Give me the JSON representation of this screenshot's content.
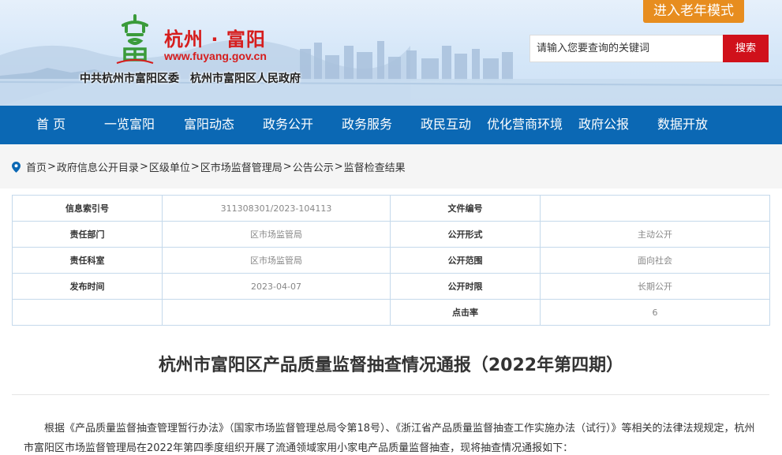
{
  "header": {
    "site_name": "杭州 · 富阳",
    "site_url": "www.fuyang.gov.cn",
    "org_1": "中共杭州市富阳区委",
    "org_2": "杭州市富阳区人民政府",
    "logo_icon": "fuyang-logo-icon",
    "elder_mode_label": "进入老年模式",
    "search_placeholder": "请输入您要查询的关键词",
    "search_button": "搜索",
    "colors": {
      "brand_red": "#d61d1d",
      "nav_blue": "#0b68b4",
      "elder_orange": "#e78d1f",
      "search_red": "#d0111b"
    }
  },
  "nav": {
    "items": [
      {
        "label": "首 页"
      },
      {
        "label": "一览富阳"
      },
      {
        "label": "富阳动态"
      },
      {
        "label": "政务公开"
      },
      {
        "label": "政务服务"
      },
      {
        "label": "政民互动"
      },
      {
        "label": "优化营商环境"
      },
      {
        "label": "政府公报"
      },
      {
        "label": "数据开放"
      }
    ]
  },
  "breadcrumb": {
    "icon": "location-pin-icon",
    "items": [
      "首页",
      "政府信息公开目录",
      "区级单位",
      "区市场监督管理局",
      "公告公示",
      "监督检查结果"
    ],
    "separator": ">"
  },
  "info": {
    "rows": [
      {
        "k1": "信息索引号",
        "v1": "311308301/2023-104113",
        "k2": "文件编号",
        "v2": ""
      },
      {
        "k1": "责任部门",
        "v1": "区市场监管局",
        "k2": "公开形式",
        "v2": "主动公开"
      },
      {
        "k1": "责任科室",
        "v1": "区市场监管局",
        "k2": "公开范围",
        "v2": "面向社会"
      },
      {
        "k1": "发布时间",
        "v1": "2023-04-07",
        "k2": "公开时限",
        "v2": "长期公开"
      },
      {
        "k1": "",
        "v1": "",
        "k2": "点击率",
        "v2": "6"
      }
    ]
  },
  "article": {
    "title": "杭州市富阳区产品质量监督抽查情况通报（2022年第四期）",
    "paragraph": "根据《产品质量监督抽查管理暂行办法》（国家市场监督管理总局令第18号）、《浙江省产品质量监督抽查工作实施办法（试行）》等相关的法律法规规定，杭州市富阳区市场监督管理局在2022年第四季度组织开展了流通领域家用小家电产品质量监督抽查，现将抽查情况通报如下："
  }
}
